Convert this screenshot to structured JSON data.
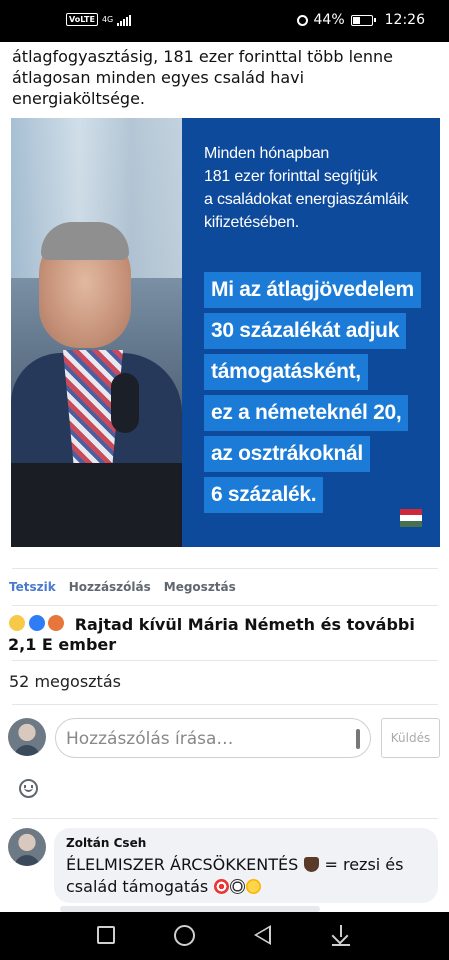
{
  "status_bar": {
    "volte": "VoLTE",
    "network": "4G",
    "battery_percent": "44%",
    "battery_level": 0.44,
    "time": "12:26"
  },
  "post": {
    "text": "átlagfogyasztásig, 181 ezer forinttal több lenne átlagosan minden egyes család havi energiaköltsége.",
    "image": {
      "lines": [
        "Minden hónapban",
        "181 ezer forinttal segítjük",
        "a családokat energiaszámláik",
        "kifizetésében."
      ],
      "highlight_lines": [
        "Mi az átlagjövedelem",
        "30 százalékát adjuk",
        "támogatásként,",
        "ez a németeknél 20,",
        "az osztrákoknál",
        "6 százalék."
      ]
    }
  },
  "actions": {
    "like": "Tetszik",
    "comment": "Hozzászólás",
    "share": "Megosztás"
  },
  "reactions": {
    "summary": "Rajtad kívül Mária Németh és további 2,1 E ember",
    "icons": [
      "haha-icon",
      "like-icon",
      "angry-icon"
    ]
  },
  "shares": "52 megosztás",
  "comment_box": {
    "placeholder": "Hozzászólás írása…",
    "send": "Küldés"
  },
  "comments": [
    {
      "author": "Zoltán Cseh",
      "text": "ÉLELMISZER ÁRCSÖKKENTÉS",
      "text_mid": " = rezsi és család támogatás "
    }
  ]
}
